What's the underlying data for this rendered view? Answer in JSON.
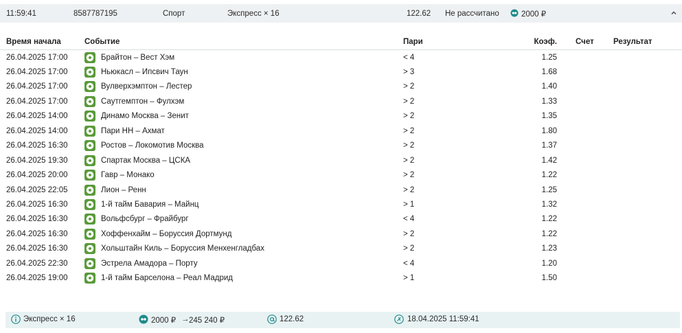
{
  "header": {
    "time": "11:59:41",
    "bet_id": "8587787195",
    "sport": "Спорт",
    "type": "Экспресс × 16",
    "total_odds": "122.62",
    "status": "Не рассчитано",
    "stake": "2000 ₽"
  },
  "columns": {
    "time": "Время начала",
    "event": "Событие",
    "bet": "Пари",
    "odds": "Коэф.",
    "score": "Счет",
    "result": "Результат"
  },
  "rows": [
    {
      "time": "26.04.2025 17:00",
      "event": "Брайтон – Вест Хэм",
      "bet": "< 4",
      "odds": "1.25"
    },
    {
      "time": "26.04.2025 17:00",
      "event": "Ньюкасл – Ипсвич Таун",
      "bet": "> 3",
      "odds": "1.68"
    },
    {
      "time": "26.04.2025 17:00",
      "event": "Вулверхэмптон – Лестер",
      "bet": "> 2",
      "odds": "1.40"
    },
    {
      "time": "26.04.2025 17:00",
      "event": "Саутгемптон – Фулхэм",
      "bet": "> 2",
      "odds": "1.33"
    },
    {
      "time": "26.04.2025 14:00",
      "event": "Динамо Москва – Зенит",
      "bet": "> 2",
      "odds": "1.35"
    },
    {
      "time": "26.04.2025 14:00",
      "event": "Пари НН – Ахмат",
      "bet": "> 2",
      "odds": "1.80"
    },
    {
      "time": "26.04.2025 16:30",
      "event": "Ростов – Локомотив Москва",
      "bet": "> 2",
      "odds": "1.37"
    },
    {
      "time": "26.04.2025 19:30",
      "event": "Спартак Москва – ЦСКА",
      "bet": "> 2",
      "odds": "1.42"
    },
    {
      "time": "26.04.2025 20:00",
      "event": "Гавр – Монако",
      "bet": "> 2",
      "odds": "1.22"
    },
    {
      "time": "26.04.2025 22:05",
      "event": "Лион – Ренн",
      "bet": "> 2",
      "odds": "1.25"
    },
    {
      "time": "26.04.2025 16:30",
      "event": "1-й тайм Бавария – Майнц",
      "bet": "> 1",
      "odds": "1.32"
    },
    {
      "time": "26.04.2025 16:30",
      "event": "Вольфсбург – Фрайбург",
      "bet": "< 4",
      "odds": "1.22"
    },
    {
      "time": "26.04.2025 16:30",
      "event": "Хоффенхайм – Боруссия Дортмунд",
      "bet": "> 2",
      "odds": "1.22"
    },
    {
      "time": "26.04.2025 16:30",
      "event": "Хольштайн Киль – Боруссия Менхенгладбах",
      "bet": "> 2",
      "odds": "1.23"
    },
    {
      "time": "26.04.2025 22:30",
      "event": "Эстрела Амадора – Порту",
      "bet": "< 4",
      "odds": "1.20"
    },
    {
      "time": "26.04.2025 19:00",
      "event": "1-й тайм Барселона – Реал Мадрид",
      "bet": "> 1",
      "odds": "1.50"
    }
  ],
  "footer": {
    "type": "Экспресс × 16",
    "stake": "2000 ₽",
    "arrow": "→",
    "payout": "245 240 ₽",
    "odds": "122.62",
    "datetime": "18.04.2025 11:59:41"
  },
  "colors": {
    "accent": "#1f8a8a",
    "sport_icon": "#5a9a3a",
    "topbar_bg": "#eef1f3",
    "footer_bg": "#e8f2f3"
  },
  "icons": {
    "status": "coin-icon",
    "sport": "soccer-ball-icon",
    "collapse": "chevron-up-icon",
    "info": "info-icon",
    "odds": "at-sign-icon",
    "date": "clock-icon"
  }
}
